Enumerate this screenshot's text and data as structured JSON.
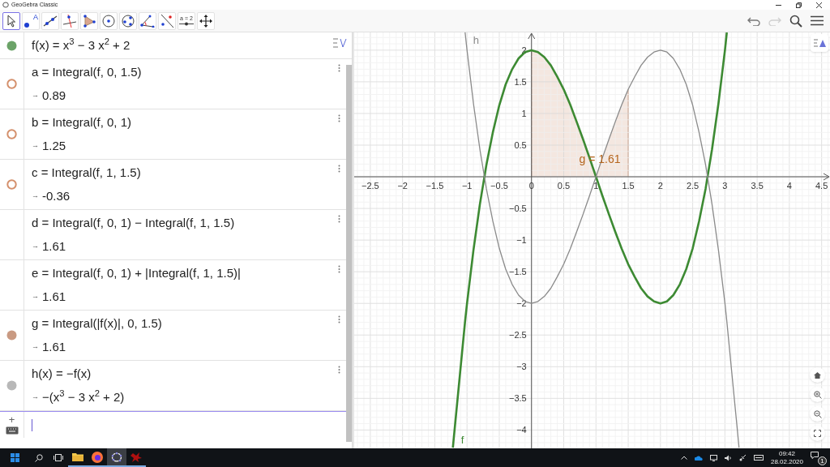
{
  "window": {
    "title": "GeoGebra Classic"
  },
  "toolbar": {
    "tools": [
      {
        "kind": "pointer",
        "selected": true
      },
      {
        "kind": "point",
        "selected": false,
        "icon_text": "A"
      },
      {
        "kind": "line",
        "selected": false
      },
      {
        "kind": "perpendicular",
        "selected": false
      },
      {
        "kind": "polygon",
        "selected": false
      },
      {
        "kind": "circle",
        "selected": false
      },
      {
        "kind": "circle3",
        "selected": false
      },
      {
        "kind": "angle",
        "selected": false
      },
      {
        "kind": "reflect",
        "selected": false
      },
      {
        "kind": "slider",
        "selected": false,
        "icon_text": "a = 2"
      },
      {
        "kind": "move",
        "selected": false
      }
    ],
    "undo": {
      "disabled": false
    },
    "redo": {
      "disabled": true
    }
  },
  "algebra": {
    "rows": [
      {
        "kind": "filled",
        "color": "#6ba368",
        "input": "f(x) = x$^{3}$ − 3 x$^{2}$ + 2"
      },
      {
        "kind": "hollow",
        "color": "#d4906c",
        "input": "a = Integral(f, 0, 1.5)",
        "arrow": "→",
        "output": "0.89"
      },
      {
        "kind": "hollow",
        "color": "#d4906c",
        "input": "b = Integral(f, 0, 1)",
        "arrow": "→",
        "output": "1.25"
      },
      {
        "kind": "hollow",
        "color": "#d4906c",
        "input": "c = Integral(f, 1, 1.5)",
        "arrow": "→",
        "output": "-0.36"
      },
      {
        "kind": "none",
        "input": "d = Integral(f, 0, 1) − Integral(f, 1, 1.5)",
        "arrow": "→",
        "output": "1.61"
      },
      {
        "kind": "none",
        "input": "e = Integral(f, 0, 1) + |Integral(f, 1, 1.5)|",
        "arrow": "→",
        "output": "1.61"
      },
      {
        "kind": "filled",
        "color": "#c99a82",
        "input": "g = Integral(|f(x)|, 0, 1.5)",
        "arrow": "→",
        "output": "1.61"
      },
      {
        "kind": "filled",
        "color": "#b8b8b8",
        "input": "h(x) = −f(x)",
        "arrow": "→",
        "output": "−(x$^{3}$ − 3 x$^{2}$ + 2)"
      }
    ],
    "input_bar": {
      "plus": "+"
    }
  },
  "graphics": {
    "shaded_area": {
      "color": "#f4e7e0"
    },
    "chart_data": {
      "type": "line",
      "grid": true,
      "xlim": [
        -2.75,
        4.63
      ],
      "ylim": [
        -4.29,
        2.28
      ],
      "x": [
        -1.22,
        -1.03,
        -1.0,
        -0.9,
        -0.8,
        -0.7,
        -0.6,
        -0.5,
        -0.4,
        -0.3,
        -0.2,
        -0.1,
        0,
        0.1,
        0.2,
        0.3,
        0.4,
        0.5,
        0.6,
        0.7,
        0.8,
        0.9,
        1.0,
        1.1,
        1.2,
        1.3,
        1.4,
        1.5,
        1.6,
        1.7,
        1.8,
        1.9,
        2.0,
        2.1,
        2.2,
        2.3,
        2.4,
        2.5,
        2.6,
        2.7,
        2.8,
        2.9,
        3.0,
        3.03,
        3.22
      ],
      "series": [
        {
          "name": "f",
          "color": "#3d8a33",
          "values": [
            -4.28,
            -2.28,
            -2,
            -1.16,
            -0.43,
            0.19,
            0.7,
            1.13,
            1.46,
            1.7,
            1.87,
            1.97,
            2,
            1.97,
            1.89,
            1.76,
            1.58,
            1.38,
            1.14,
            0.87,
            0.59,
            0.3,
            0,
            -0.3,
            -0.59,
            -0.87,
            -1.14,
            -1.38,
            -1.58,
            -1.76,
            -1.89,
            -1.97,
            -2,
            -1.97,
            -1.87,
            -1.7,
            -1.46,
            -1.13,
            -0.7,
            -0.19,
            0.43,
            1.16,
            2,
            2.28,
            null
          ]
        },
        {
          "name": "h",
          "color": "#8a8a8a",
          "values": [
            null,
            2.28,
            2,
            1.16,
            0.43,
            -0.19,
            -0.7,
            -1.13,
            -1.46,
            -1.7,
            -1.87,
            -1.97,
            -2,
            -1.97,
            -1.89,
            -1.76,
            -1.58,
            -1.38,
            -1.14,
            -0.87,
            -0.59,
            -0.3,
            0,
            0.3,
            0.59,
            0.87,
            1.14,
            1.38,
            1.58,
            1.76,
            1.89,
            1.97,
            2,
            1.97,
            1.87,
            1.7,
            1.46,
            1.13,
            0.7,
            0.19,
            -0.43,
            -1.16,
            -2,
            -2.28,
            -4.28
          ]
        }
      ],
      "xticks": [
        {
          "value": -2.5,
          "label": "−2.5"
        },
        {
          "value": -2,
          "label": "−2"
        },
        {
          "value": -1.5,
          "label": "−1.5"
        },
        {
          "value": -1,
          "label": "−1"
        },
        {
          "value": -0.5,
          "label": "−0.5"
        },
        {
          "value": 0,
          "label": "0"
        },
        {
          "value": 0.5,
          "label": "0.5"
        },
        {
          "value": 1,
          "label": "1"
        },
        {
          "value": 1.5,
          "label": "1.5"
        },
        {
          "value": 2,
          "label": "2"
        },
        {
          "value": 2.5,
          "label": "2.5"
        },
        {
          "value": 3,
          "label": "3"
        },
        {
          "value": 3.5,
          "label": "3.5"
        },
        {
          "value": 4,
          "label": "4"
        },
        {
          "value": 4.5,
          "label": "4.5"
        }
      ],
      "yticks": [
        {
          "value": -4,
          "label": "−4"
        },
        {
          "value": -3.5,
          "label": "−3.5"
        },
        {
          "value": -3,
          "label": "−3"
        },
        {
          "value": -2.5,
          "label": "−2.5"
        },
        {
          "value": -2,
          "label": "−2"
        },
        {
          "value": -1.5,
          "label": "−1.5"
        },
        {
          "value": -1,
          "label": "−1"
        },
        {
          "value": -0.5,
          "label": "−0.5"
        },
        {
          "value": 0.5,
          "label": "0.5"
        },
        {
          "value": 1,
          "label": "1"
        },
        {
          "value": 1.5,
          "label": "1.5"
        },
        {
          "value": 2,
          "label": "2"
        }
      ],
      "annotations": [
        {
          "text": "g = 1.61",
          "x": 1.06,
          "y": 0.22
        }
      ]
    }
  },
  "taskbar": {
    "apps": [
      {
        "kind": "folder",
        "selected": false
      },
      {
        "kind": "firefox",
        "selected": false
      },
      {
        "kind": "geogebra",
        "selected": true
      },
      {
        "kind": "red",
        "selected": false
      }
    ],
    "time": "09:42",
    "date": "28.02.2020",
    "notifications": "1"
  }
}
